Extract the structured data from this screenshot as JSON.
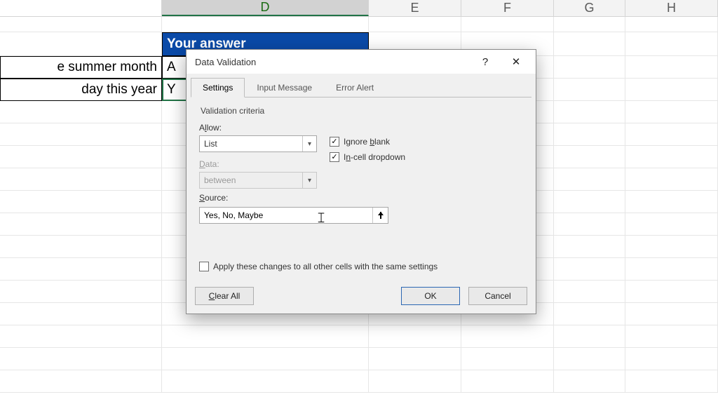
{
  "columns": [
    "",
    "D",
    "E",
    "F",
    "G",
    "H"
  ],
  "selected_column": "D",
  "rows": {
    "header": {
      "d": "Your answer"
    },
    "r1": {
      "c": "e summer month",
      "d": "A"
    },
    "r2": {
      "c": "day this year",
      "d": "Y"
    }
  },
  "dialog": {
    "title": "Data Validation",
    "help_symbol": "?",
    "close_symbol": "✕",
    "tabs": {
      "settings": "Settings",
      "input_message": "Input Message",
      "error_alert": "Error Alert"
    },
    "group_label": "Validation criteria",
    "allow": {
      "label_pre": "A",
      "label_ul": "l",
      "label_post": "low:",
      "value": "List"
    },
    "data": {
      "label_pre": "",
      "label_ul": "D",
      "label_post": "ata:",
      "value": "between"
    },
    "ignore_blank": {
      "checked": true,
      "pre": "Ignore ",
      "ul": "b",
      "post": "lank"
    },
    "in_cell": {
      "checked": true,
      "pre": "I",
      "ul": "n",
      "post": "-cell dropdown"
    },
    "source": {
      "label_pre": "",
      "label_ul": "S",
      "label_post": "ource:",
      "value": "Yes, No, Maybe"
    },
    "apply": {
      "checked": false,
      "pre": "Apply these changes to all other cells with the same settings",
      "ul": "P"
    },
    "buttons": {
      "clear_pre": "",
      "clear_ul": "C",
      "clear_post": "lear All",
      "ok": "OK",
      "cancel": "Cancel"
    }
  }
}
